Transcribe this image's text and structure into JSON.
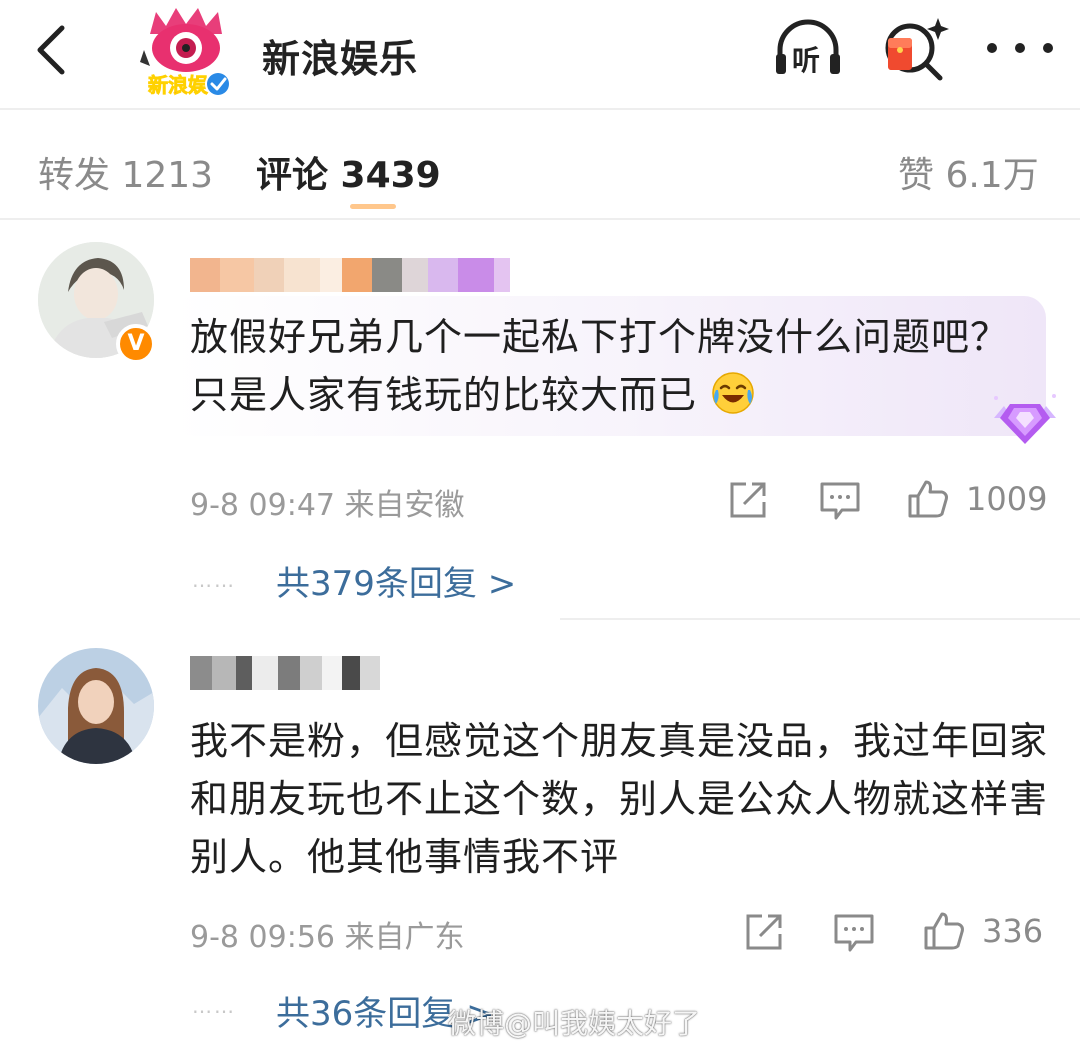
{
  "header": {
    "title": "新浪娱乐",
    "avatar_label": "新浪娱",
    "listen_label": "听",
    "icons": [
      "back-arrow-icon",
      "listen-icon",
      "red-packet-search-icon",
      "more-icon"
    ]
  },
  "tabs": {
    "repost": "转发 1213",
    "comments": "评论 3439",
    "likes": "赞 6.1万"
  },
  "comments": [
    {
      "text": "放假好兄弟几个一起私下打个牌没什么问题吧？只是人家有钱玩的比较大而已",
      "emoji": "laugh-cry-emoji",
      "verified_badge": "V",
      "meta": "9-8 09:47 来自安徽",
      "likes": "1009",
      "replies": "共379条回复 >"
    },
    {
      "text": "我不是粉，但感觉这个朋友真是没品，我过年回家和朋友玩也不止这个数，别人是公众人物就这样害别人。他其他事情我不评",
      "meta": "9-8 09:56 来自广东",
      "likes": "336",
      "replies": "共36条回复 >"
    }
  ],
  "reply_dots": "……",
  "watermark": "微博@叫我姨太好了",
  "colors": {
    "link": "#3c6d9b",
    "meta": "#9a9a9a",
    "verified": "#ff8a00",
    "tab_indicator": "#ff8200"
  }
}
